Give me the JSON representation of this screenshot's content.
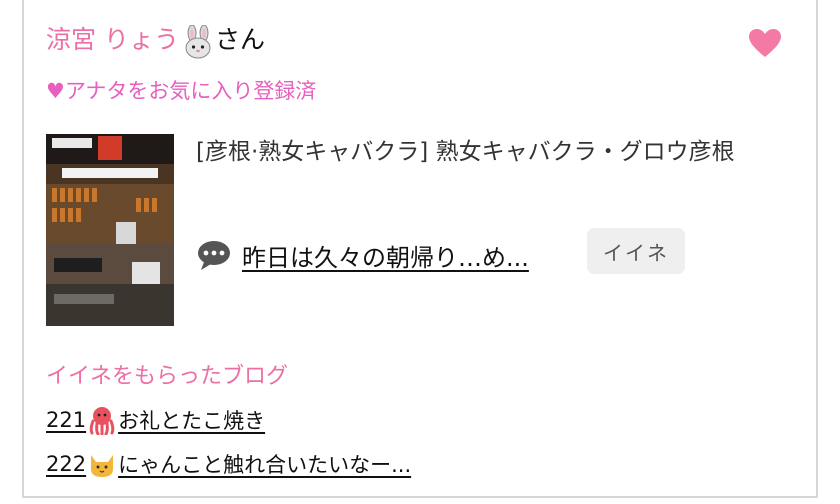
{
  "profile": {
    "name": "涼宮 りょう",
    "name_icon": "rabbit-icon",
    "suffix": "さん",
    "favorite_icon": "heart-icon",
    "favorite_status": "♥アナタをお気に入り登録済",
    "accent_color": "#ec6fa6"
  },
  "latest_post": {
    "thumbnail_icon": "shop-photo-thumbnail",
    "category": "[彦根·熟女キャバクラ]  熟女キャバクラ・グロウ彦根",
    "blog_icon": "speech-bubble-icon",
    "blog_title": "昨日は久々の朝帰り…め...",
    "like_button": "イイネ"
  },
  "liked_blogs": {
    "title": "イイネをもらったブログ",
    "items": [
      {
        "count": "221",
        "icon": "octopus-icon",
        "title": "お礼とたこ焼き"
      },
      {
        "count": "222",
        "icon": "cat-icon",
        "title": "にゃんこと触れ合いたいなー..."
      }
    ]
  }
}
